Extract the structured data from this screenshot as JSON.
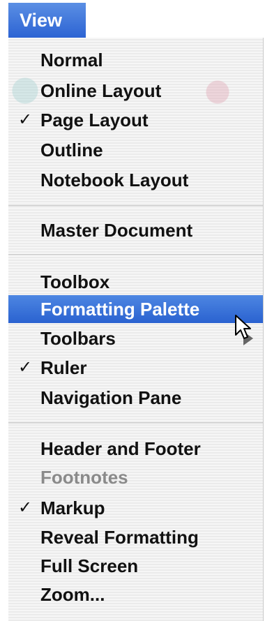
{
  "menu": {
    "title": "View",
    "items": [
      {
        "label": "Normal",
        "checked": false
      },
      {
        "label": "Online Layout",
        "checked": false
      },
      {
        "label": "Page Layout",
        "checked": true
      },
      {
        "label": "Outline",
        "checked": false
      },
      {
        "label": "Notebook Layout",
        "checked": false
      },
      {
        "label": "Master Document",
        "checked": false
      },
      {
        "label": "Toolbox",
        "checked": false
      },
      {
        "label": "Formatting Palette",
        "checked": false,
        "highlighted": true
      },
      {
        "label": "Toolbars",
        "checked": false,
        "submenu": true
      },
      {
        "label": "Ruler",
        "checked": true
      },
      {
        "label": "Navigation Pane",
        "checked": false
      },
      {
        "label": "Header and Footer",
        "checked": false
      },
      {
        "label": "Footnotes",
        "checked": false,
        "disabled": true
      },
      {
        "label": "Markup",
        "checked": true
      },
      {
        "label": "Reveal Formatting",
        "checked": false
      },
      {
        "label": "Full Screen",
        "checked": false
      },
      {
        "label": "Zoom...",
        "checked": false
      }
    ],
    "check_glyph": "✓"
  },
  "colors": {
    "highlight": "#2f68d6",
    "menu_bg": "#f2f2f2",
    "disabled_text": "#8a8a8a"
  }
}
